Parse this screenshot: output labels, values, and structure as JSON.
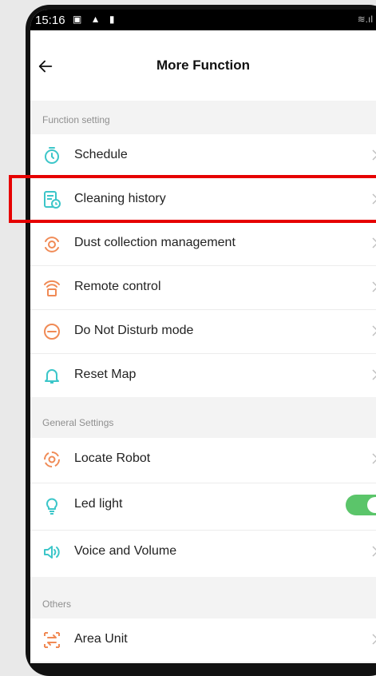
{
  "status_bar": {
    "time": "15:16",
    "icons": "▣ ▲ ▮",
    "right_icons": "≋.ıl"
  },
  "header": {
    "title": "More Function"
  },
  "sections": {
    "function_setting": "Function setting",
    "general_settings": "General Settings",
    "others": "Others"
  },
  "items": {
    "schedule": "Schedule",
    "cleaning_history": "Cleaning history",
    "dust_collection": "Dust collection management",
    "remote_control": "Remote control",
    "do_not_disturb": "Do Not Disturb mode",
    "reset_map": "Reset Map",
    "locate_robot": "Locate Robot",
    "led_light": "Led light",
    "voice_volume": "Voice and Volume",
    "area_unit": "Area Unit"
  },
  "led_light_enabled": true,
  "colors": {
    "teal": "#3cc6c9",
    "orange": "#f08a55",
    "toggle_on": "#5bc56a",
    "highlight": "#e60000"
  }
}
